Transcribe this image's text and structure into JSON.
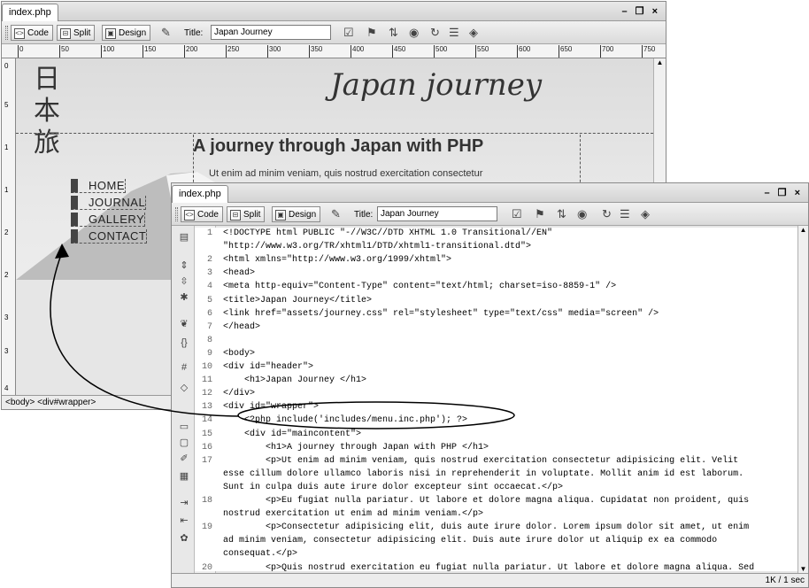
{
  "back": {
    "tab": "index.php",
    "window_controls": "- &#x2750; ×",
    "toolbar": {
      "code": "Code",
      "split": "Split",
      "design": "Design",
      "title_label": "Title:",
      "title_value": "Japan Journey"
    },
    "ruler": [
      "0",
      "50",
      "100",
      "150",
      "200",
      "250",
      "300",
      "350",
      "400",
      "450",
      "500",
      "550",
      "600",
      "650",
      "700",
      "750"
    ],
    "vruler": [
      "0",
      "5",
      "1",
      "1",
      "2",
      "2",
      "3",
      "3",
      "4"
    ],
    "kanji": [
      "日",
      "本",
      "旅"
    ],
    "heading": "Japan journey",
    "subheading": "A journey through Japan with PHP",
    "para": "Ut enim ad minim veniam, quis nostrud exercitation consectetur",
    "menu": [
      "HOME",
      "JOURNAL",
      "GALLERY",
      "CONTACT"
    ],
    "status": "<body> <div#wrapper>"
  },
  "front": {
    "tab": "index.php",
    "window_controls": "_ ❐ ×",
    "toolbar": {
      "code": "Code",
      "split": "Split",
      "design": "Design",
      "title_label": "Title:",
      "title_value": "Japan Journey"
    },
    "status": "1K / 1 sec",
    "lines": [
      {
        "n": "1",
        "t": "<!DOCTYPE html PUBLIC \"-//W3C//DTD XHTML 1.0 Transitional//EN\""
      },
      {
        "n": "",
        "t": "\"http://www.w3.org/TR/xhtml1/DTD/xhtml1-transitional.dtd\">"
      },
      {
        "n": "2",
        "t": "<html xmlns=\"http://www.w3.org/1999/xhtml\">"
      },
      {
        "n": "3",
        "t": "<head>"
      },
      {
        "n": "4",
        "t": "<meta http-equiv=\"Content-Type\" content=\"text/html; charset=iso-8859-1\" />"
      },
      {
        "n": "5",
        "t": "<title>Japan Journey</title>"
      },
      {
        "n": "6",
        "t": "<link href=\"assets/journey.css\" rel=\"stylesheet\" type=\"text/css\" media=\"screen\" />"
      },
      {
        "n": "7",
        "t": "</head>"
      },
      {
        "n": "8",
        "t": ""
      },
      {
        "n": "9",
        "t": "<body>"
      },
      {
        "n": "10",
        "t": "<div id=\"header\">"
      },
      {
        "n": "11",
        "t": "    <h1>Japan Journey </h1>"
      },
      {
        "n": "12",
        "t": "</div>"
      },
      {
        "n": "13",
        "t": "<div id=\"wrapper\">"
      },
      {
        "n": "14",
        "t": "    <?php include('includes/menu.inc.php'); ?>"
      },
      {
        "n": "15",
        "t": "    <div id=\"maincontent\">"
      },
      {
        "n": "16",
        "t": "        <h1>A journey through Japan with PHP </h1>"
      },
      {
        "n": "17",
        "t": "        <p>Ut enim ad minim veniam, quis nostrud exercitation consectetur adipisicing elit. Velit"
      },
      {
        "n": "",
        "t": "esse cillum dolore ullamco laboris nisi in reprehenderit in voluptate. Mollit anim id est laborum."
      },
      {
        "n": "",
        "t": "Sunt in culpa duis aute irure dolor excepteur sint occaecat.</p>"
      },
      {
        "n": "18",
        "t": "        <p>Eu fugiat nulla pariatur. Ut labore et dolore magna aliqua. Cupidatat non proident, quis"
      },
      {
        "n": "",
        "t": "nostrud exercitation ut enim ad minim veniam.</p>"
      },
      {
        "n": "19",
        "t": "        <p>Consectetur adipisicing elit, duis aute irure dolor. Lorem ipsum dolor sit amet, ut enim"
      },
      {
        "n": "",
        "t": "ad minim veniam, consectetur adipisicing elit. Duis aute irure dolor ut aliquip ex ea commodo"
      },
      {
        "n": "",
        "t": "consequat.</p>"
      },
      {
        "n": "20",
        "t": "        <p>Quis nostrud exercitation eu fugiat nulla pariatur. Ut labore et dolore magna aliqua. Sed"
      }
    ]
  }
}
